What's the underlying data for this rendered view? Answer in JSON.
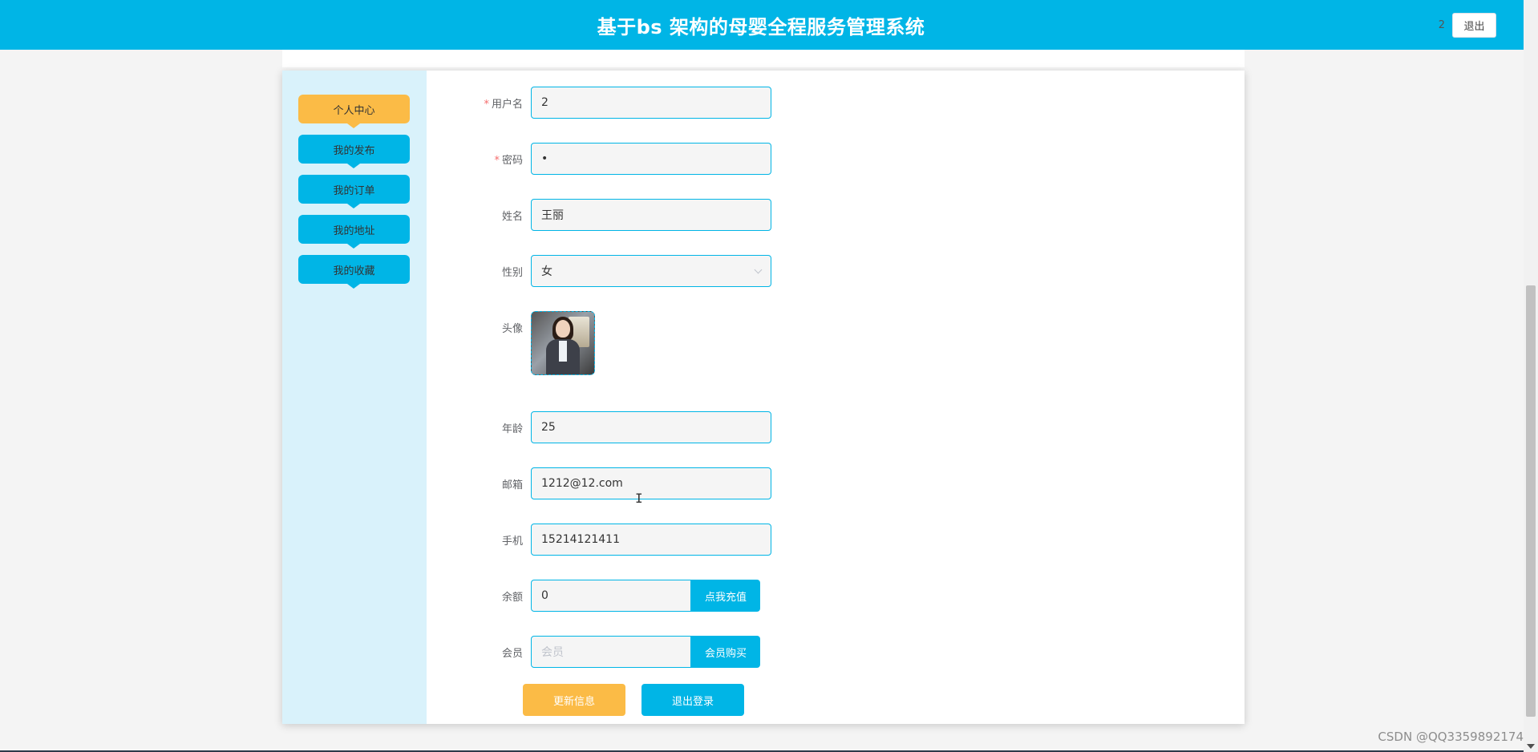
{
  "header": {
    "title": "基于bs 架构的母婴全程服务管理系统",
    "username": "2",
    "logout_label": "退出"
  },
  "sidebar": {
    "items": [
      {
        "label": "个人中心",
        "active": true
      },
      {
        "label": "我的发布",
        "active": false
      },
      {
        "label": "我的订单",
        "active": false
      },
      {
        "label": "我的地址",
        "active": false
      },
      {
        "label": "我的收藏",
        "active": false
      }
    ]
  },
  "form": {
    "username": {
      "label": "用户名",
      "required": "*",
      "value": "2"
    },
    "password": {
      "label": "密码",
      "required": "*",
      "value": "•"
    },
    "name": {
      "label": "姓名",
      "value": "王丽"
    },
    "gender": {
      "label": "性别",
      "value": "女"
    },
    "avatar": {
      "label": "头像"
    },
    "age": {
      "label": "年龄",
      "value": "25"
    },
    "email": {
      "label": "邮箱",
      "value": "1212@12.com"
    },
    "phone": {
      "label": "手机",
      "value": "15214121411"
    },
    "balance": {
      "label": "余额",
      "value": "0",
      "button": "点我充值"
    },
    "member": {
      "label": "会员",
      "placeholder": "会员",
      "button": "会员购买"
    }
  },
  "actions": {
    "update_label": "更新信息",
    "logout_label": "退出登录"
  },
  "watermark": "CSDN @QQ3359892174",
  "colors": {
    "primary": "#00b5e6",
    "accent": "#fbbb46",
    "sidebar_bg": "#d9f2fb"
  }
}
